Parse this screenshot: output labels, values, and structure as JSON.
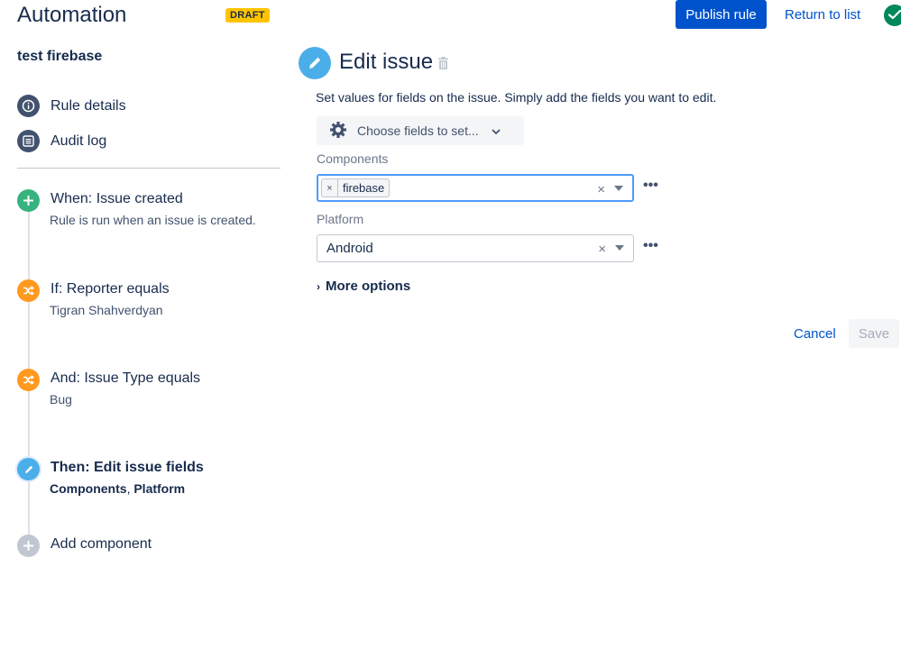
{
  "header": {
    "app_title": "Automation",
    "status_badge": "DRAFT",
    "publish_label": "Publish rule",
    "return_label": "Return to list"
  },
  "sidebar": {
    "rule_name": "test firebase",
    "links": [
      {
        "label": "Rule details",
        "icon": "info-icon"
      },
      {
        "label": "Audit log",
        "icon": "list-icon"
      }
    ],
    "steps": [
      {
        "title": "When: Issue created",
        "subtitle": "Rule is run when an issue is created.",
        "icon": "plus-icon",
        "color": "#36b37e"
      },
      {
        "title": "If: Reporter equals",
        "subtitle": "Tigran Shahverdyan",
        "icon": "shuffle-icon",
        "color": "#ff991f"
      },
      {
        "title": "And: Issue Type equals",
        "subtitle": "Bug",
        "icon": "shuffle-icon",
        "color": "#ff991f"
      },
      {
        "title": "Then: Edit issue fields",
        "subtitle_parts": [
          "Components",
          ", ",
          "Platform"
        ],
        "icon": "pencil-icon",
        "color": "#4baee8",
        "active": true
      },
      {
        "title": "Add component",
        "icon": "plus-icon",
        "color": "#c1c7d0"
      }
    ]
  },
  "panel": {
    "title": "Edit issue",
    "description": "Set values for fields on the issue. Simply add the fields you want to edit.",
    "choose_fields_label": "Choose fields to set...",
    "fields": [
      {
        "label": "Components",
        "tags": [
          "firebase"
        ],
        "tag_remove": "×",
        "clear": "×"
      },
      {
        "label": "Platform",
        "value": "Android",
        "clear": "×"
      }
    ],
    "more_options_label": "More options",
    "more_options_chevron": "›",
    "field_menu": "•••",
    "cancel_label": "Cancel",
    "save_label": "Save"
  },
  "colors": {
    "primary": "#0052cc",
    "draft": "#ffc400",
    "success": "#00875a"
  }
}
